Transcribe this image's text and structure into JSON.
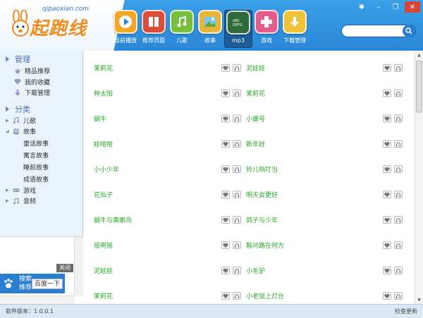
{
  "logo": {
    "url": "qipaoxian.com",
    "name": "起跑线"
  },
  "toolbar": [
    {
      "label": "当前播放",
      "icon": "play-icon",
      "color": "#f3a624"
    },
    {
      "label": "推荐页面",
      "icon": "book-icon",
      "color": "#d94d3a"
    },
    {
      "label": "儿歌",
      "icon": "music-note-icon",
      "color": "#77bf3d"
    },
    {
      "label": "故事",
      "icon": "landscape-icon",
      "color": "#e8b43a"
    },
    {
      "label": "mp3",
      "icon": "chalkboard-icon",
      "color": "#2f6b3a"
    },
    {
      "label": "游戏",
      "icon": "gamepad-icon",
      "color": "#e35c8c"
    },
    {
      "label": "下载管理",
      "icon": "download-icon",
      "color": "#f0c23a"
    }
  ],
  "search": {
    "placeholder": ""
  },
  "sidebar": {
    "manage_title": "管理",
    "manage_items": [
      {
        "label": "精品推荐",
        "icon": "star-icon"
      },
      {
        "label": "我的收藏",
        "icon": "heart-icon"
      },
      {
        "label": "下载管理",
        "icon": "download-arrow-icon"
      }
    ],
    "category_title": "分类",
    "categories": [
      {
        "label": "儿歌",
        "icon": "music-note-icon",
        "expanded": false
      },
      {
        "label": "故事",
        "icon": "book-icon",
        "expanded": true
      },
      {
        "label": "游戏",
        "icon": "gamepad-icon",
        "expanded": false
      },
      {
        "label": "音频",
        "icon": "music-note-icon",
        "expanded": false
      }
    ],
    "story_children": [
      "童话故事",
      "寓言故事",
      "睡前故事",
      "成语故事"
    ]
  },
  "ad": {
    "close_label": "关闭",
    "search_text": "搜索 推荐",
    "button": "百度一下"
  },
  "songs": [
    [
      "茉莉花",
      "泥娃娃"
    ],
    [
      "种太阳",
      "茉莉花"
    ],
    [
      "蜗牛",
      "小螺号"
    ],
    [
      "娃哈哈",
      "新年好"
    ],
    [
      "小小少年",
      "铃儿响叮当"
    ],
    [
      "花仙子",
      "明天会更好"
    ],
    [
      "蜗牛与黄鹂鸟",
      "鸽子与少年"
    ],
    [
      "摇啊摇",
      "鞍问路在何方"
    ],
    [
      "泥娃娃",
      "小毛驴"
    ],
    [
      "茉莉花",
      "小老鼠上灯台"
    ]
  ],
  "status": {
    "version": "软件版本：1.0.0.1",
    "check_update": "检查更新"
  }
}
